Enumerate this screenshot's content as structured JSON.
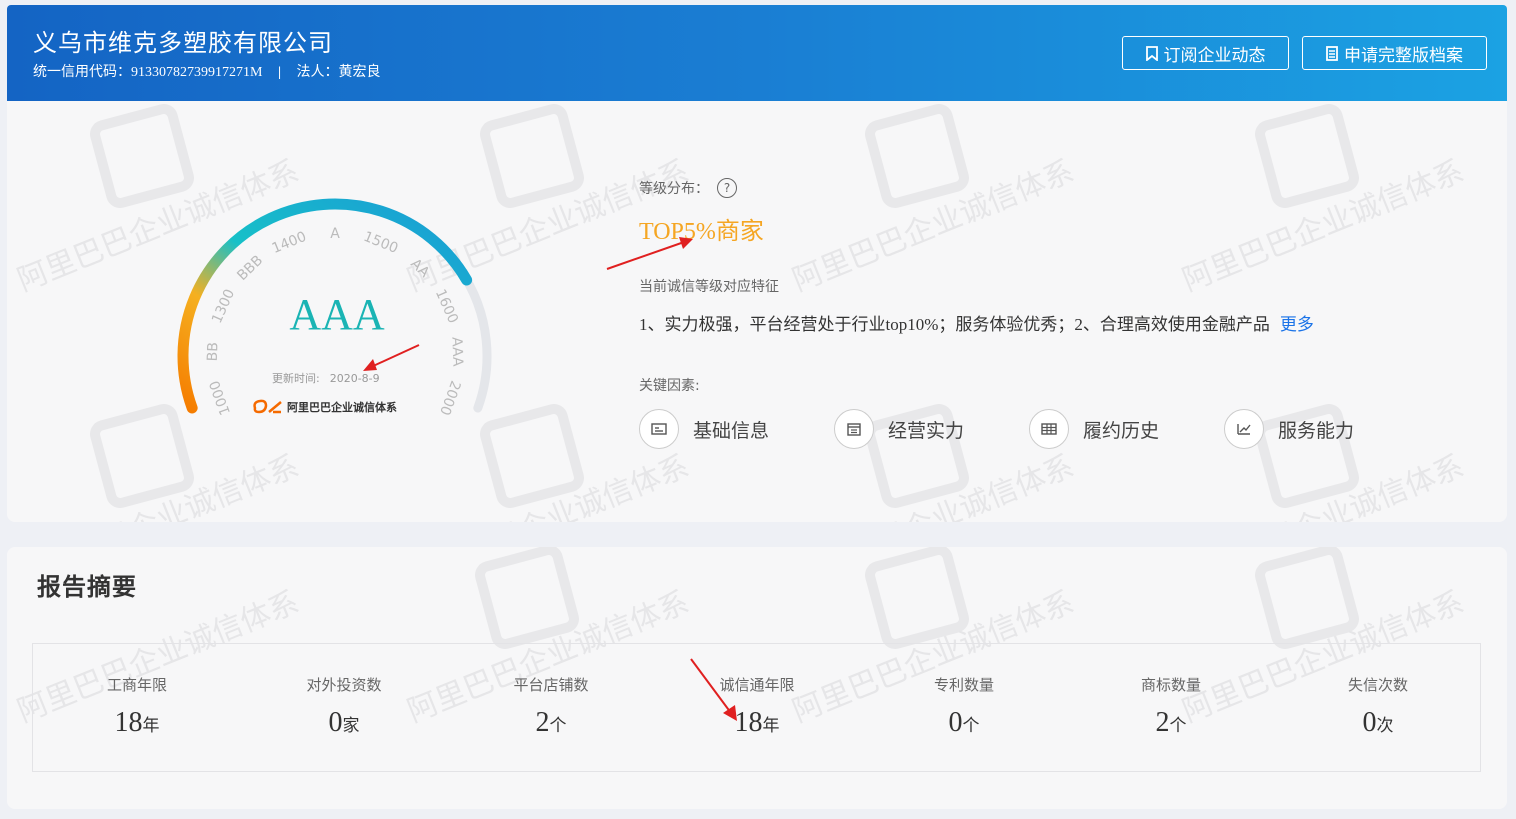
{
  "header": {
    "company_name": "义乌市维克多塑胶有限公司",
    "credit_code_label": "统一信用代码：",
    "credit_code": "91330782739917271M",
    "legal_label": "法人：",
    "legal_person": "黄宏良",
    "subscribe_button": "订阅企业动态",
    "apply_button": "申请完整版档案"
  },
  "gauge": {
    "grade": "AAA",
    "update_label": "更新时间:",
    "update_date": "2020-8-9",
    "brand": "阿里巴巴企业诚信体系",
    "scale_labels": [
      "1000",
      "BB",
      "1300",
      "BBB",
      "1400",
      "A",
      "1500",
      "AA",
      "1600",
      "AAA",
      "2000"
    ],
    "colors": {
      "low": "#f57c00",
      "mid": "#f5b020",
      "high": "#17c0c8",
      "top": "#1a9ad6",
      "track": "#e4e6ea"
    }
  },
  "rating": {
    "distribution_label": "等级分布：",
    "distribution_value": "TOP5%商家",
    "feature_label": "当前诚信等级对应特征",
    "feature_text": "1、实力极强，平台经营处于行业top10%；服务体验优秀；2、合理高效使用金融产品",
    "more_link": "更多",
    "factors_label": "关键因素:",
    "factors": [
      {
        "label": "基础信息",
        "icon": "id-card-icon"
      },
      {
        "label": "经营实力",
        "icon": "calendar-icon"
      },
      {
        "label": "履约历史",
        "icon": "table-icon"
      },
      {
        "label": "服务能力",
        "icon": "trend-icon"
      }
    ]
  },
  "watermark": "阿里巴巴企业诚信体系",
  "summary": {
    "title": "报告摘要",
    "stats": [
      {
        "label": "工商年限",
        "value": "18",
        "unit": "年"
      },
      {
        "label": "对外投资数",
        "value": "0",
        "unit": "家"
      },
      {
        "label": "平台店铺数",
        "value": "2",
        "unit": "个"
      },
      {
        "label": "诚信通年限",
        "value": "18",
        "unit": "年"
      },
      {
        "label": "专利数量",
        "value": "0",
        "unit": "个"
      },
      {
        "label": "商标数量",
        "value": "2",
        "unit": "个"
      },
      {
        "label": "失信次数",
        "value": "0",
        "unit": "次"
      }
    ]
  }
}
